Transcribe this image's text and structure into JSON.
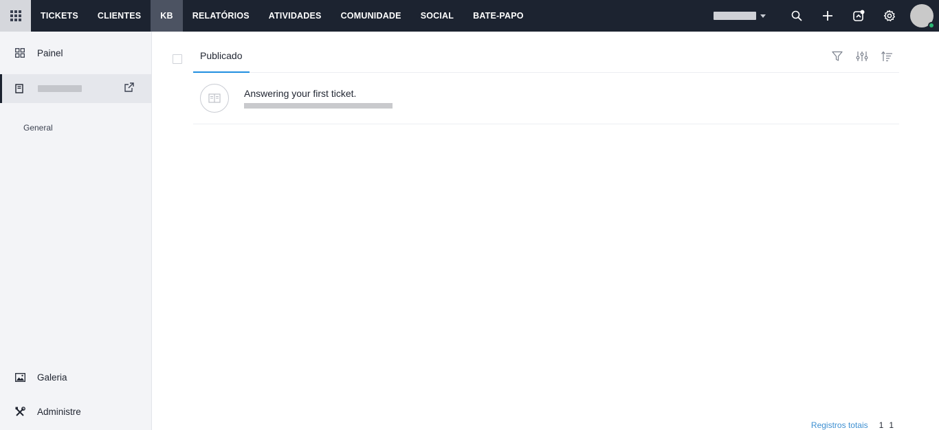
{
  "topbar": {
    "nav": [
      {
        "label": "TICKETS",
        "active": false
      },
      {
        "label": "CLIENTES",
        "active": false
      },
      {
        "label": "KB",
        "active": true
      },
      {
        "label": "RELATÓRIOS",
        "active": false
      },
      {
        "label": "ATIVIDADES",
        "active": false
      },
      {
        "label": "COMUNIDADE",
        "active": false
      },
      {
        "label": "SOCIAL",
        "active": false
      },
      {
        "label": "BATE-PAPO",
        "active": false
      }
    ],
    "icons": [
      "apps-grid-icon",
      "search-icon",
      "plus-icon",
      "compose-icon",
      "gear-icon"
    ],
    "user_status": "online"
  },
  "sidebar": {
    "painel_label": "Painel",
    "section_label": "General",
    "galeria_label": "Galeria",
    "admin_label": "Administre"
  },
  "main": {
    "tab_label": "Publicado",
    "articles": [
      {
        "title": "Answering your first ticket."
      }
    ]
  },
  "footer": {
    "total_label": "Registros totais",
    "page": "1",
    "total": "1"
  },
  "colors": {
    "topbar_bg": "#1c2330",
    "active_nav_bg": "#4c5362",
    "accent": "#1f8ee0",
    "status_online": "#2bb673",
    "link": "#3d8fd1"
  }
}
